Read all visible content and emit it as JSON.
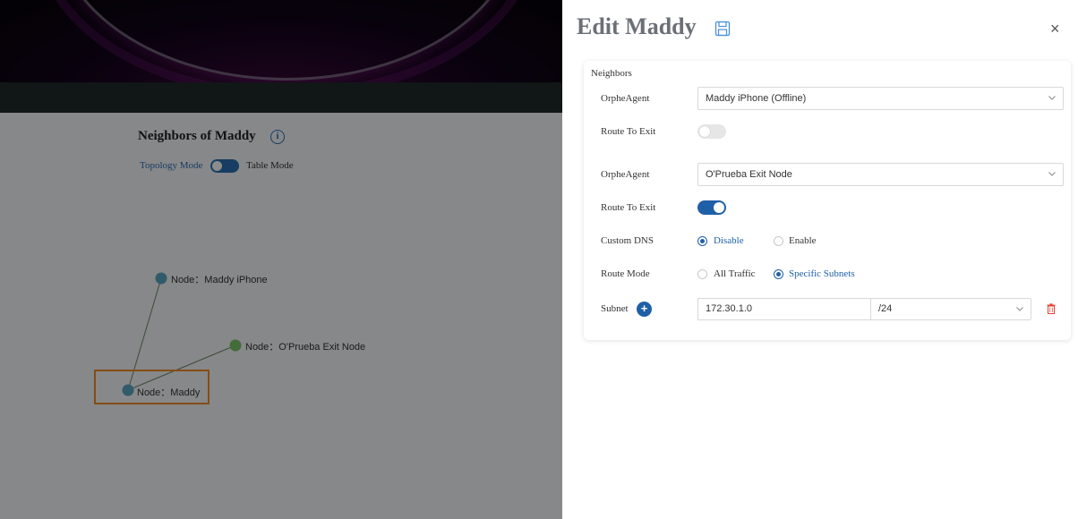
{
  "background": {
    "page_title": "Neighbors of Maddy",
    "info_icon_glyph": "i",
    "mode": {
      "topology_label": "Topology Mode",
      "table_label": "Table Mode"
    },
    "nodes": [
      {
        "label": "Node：Maddy iPhone",
        "color": "#5aa6c2"
      },
      {
        "label": "Node：O'Prueba Exit Node",
        "color": "#7cc36b"
      },
      {
        "label": "Node：Maddy",
        "color": "#5aa6c2"
      }
    ]
  },
  "drawer": {
    "title": "Edit Maddy",
    "close_glyph": "×",
    "section_label": "Neighbors",
    "neighbors": [
      {
        "agent_label": "OrpheAgent",
        "agent_value": "Maddy iPhone (Offline)",
        "route_label": "Route To Exit",
        "route_on": false
      },
      {
        "agent_label": "OrpheAgent",
        "agent_value": "O'Prueba Exit Node",
        "route_label": "Route To Exit",
        "route_on": true,
        "dns_label": "Custom DNS",
        "dns_options": [
          "Disable",
          "Enable"
        ],
        "dns_selected": "Disable",
        "route_mode_label": "Route Mode",
        "route_mode_options": [
          "All Traffic",
          "Specific Subnets"
        ],
        "route_mode_selected": "Specific Subnets",
        "subnet_label": "Subnet",
        "subnet_add_glyph": "+",
        "subnet_ip": "172.30.1.0",
        "subnet_mask": "/24"
      }
    ]
  },
  "colors": {
    "accent": "#1f5fa8",
    "highlight": "#f28c28",
    "danger": "#e0443a"
  }
}
